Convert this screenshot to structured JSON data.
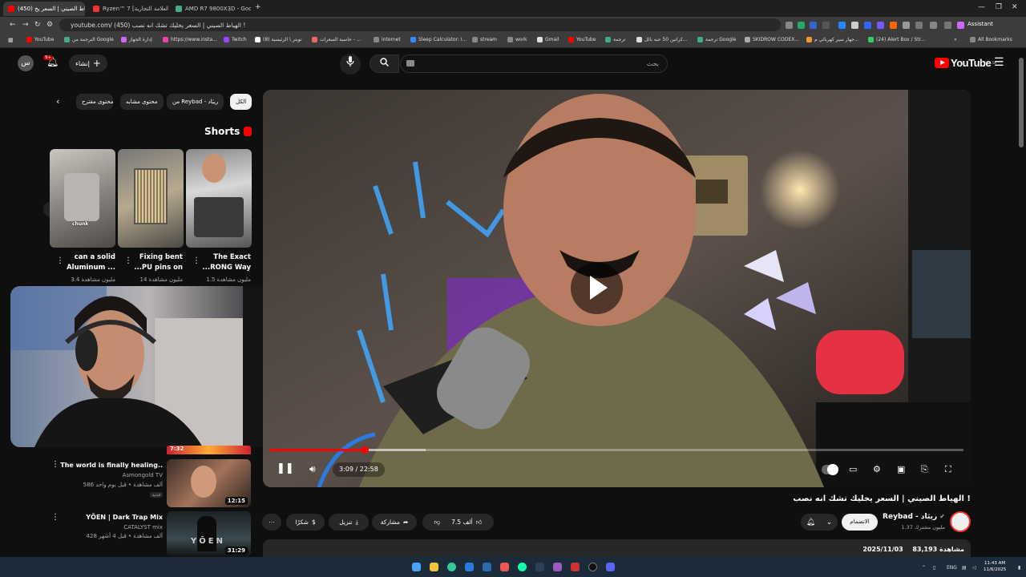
{
  "browser": {
    "tabs": [
      {
        "title": "(450) الهياط الصيني | السعر يخ"
      },
      {
        "title": "Ryzen™ 7 [العلامة التجارية"
      },
      {
        "title": "AMD R7 9800X3D - Google S"
      }
    ],
    "new_tab": "+",
    "url": "youtube.com/ (450) الهياط الصيني | السعر يخليك تشك انه نصب !",
    "assistant_label": "Assistant",
    "bookmarks": [
      "YouTube",
      "الترجمة من Google",
      "إدارة الجهاز",
      "https://www.insta...",
      "Twitch",
      "تويتر \\ الرئيسية (8)",
      "حاسبة السعرات - ...",
      "internet",
      "Sleep Calculator: I...",
      "stream",
      "work",
      "Gmail",
      "YouTube",
      "ترجمة",
      "كراتين 50 حبه بالل...",
      "ترجمة Google",
      "SKIDROW CODEX...",
      "جهاز سير كهربائي م...",
      "(24) Alert Box / Str..."
    ],
    "all_bookmarks": "All Bookmarks"
  },
  "header": {
    "search_placeholder": "بحث",
    "logo_text": "YouTube",
    "logo_region": "SA",
    "create_label": "إنشاء",
    "notification_count": "9+",
    "avatar_letter": "س"
  },
  "chips": [
    {
      "label": "الكل"
    },
    {
      "label": "من Reybad - ريبَاد"
    },
    {
      "label": "محتوى مشابه"
    },
    {
      "label": "محتوى مقترح"
    }
  ],
  "shorts": {
    "title": "Shorts",
    "items": [
      {
        "title": "The Exact ...RONG Way",
        "views": "1.5 مليون مشاهدة"
      },
      {
        "title": "Fixing bent ...PU pins on",
        "views": "14 مليون مشاهدة"
      },
      {
        "title": "can a solid Aluminum ...",
        "views": "3.4 مليون مشاهدة",
        "thumb_caption": "chunk"
      }
    ]
  },
  "recommended": [
    {
      "title": "The world is finally healing..",
      "channel": "Asmongold TV",
      "meta": "586 ألف مشاهدة • قبل يوم واحد",
      "badge": "جديد",
      "duration": "12:15"
    },
    {
      "title": "YŌEN | Dark Trap Mix",
      "channel": "CATALYST mix",
      "meta": "428 ألف مشاهدة • قبل 4 أشهر",
      "duration": "31:29",
      "thumb_caption": "YŌEN"
    }
  ],
  "webcam_overlay_duration": "7:32",
  "player": {
    "current_time": "3:09",
    "duration": "22:58",
    "time_display": "3:09 / 22:58",
    "progress": 0.137,
    "buffered": 0.225
  },
  "video": {
    "title": "الهياط الصيني | السعر يخليك تشك انه نصب !",
    "channel": "Reybad - ريبَاد",
    "subscribers": "1.37 مليون مشترك",
    "join_label": "الانضمام",
    "likes": "7.5 ألف",
    "share_label": "مشاركة",
    "download_label": "تنزيل",
    "thanks_label": "شكرًا",
    "views": "83,193 مشاهدة",
    "date": "2025/11/03"
  },
  "taskbar": {
    "lang": "ENG",
    "time": "11:43 AM",
    "date": "11/6/2025"
  },
  "colors": {
    "accent": "#ff0000",
    "background": "#0f0f0f",
    "chip_bg": "#272727"
  }
}
